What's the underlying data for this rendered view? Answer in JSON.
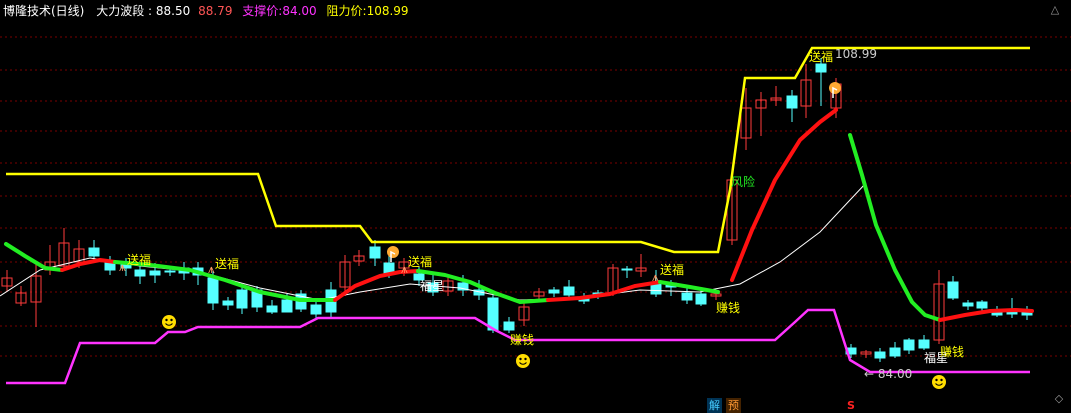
{
  "header": {
    "title": "博隆技术(日线)",
    "indicator_name": "大力波段",
    "indicator_value_1": ": 88.50",
    "indicator_value_2": "88.79",
    "support_label": "支撑价:",
    "support_value": "84.00",
    "resist_label": "阻力价:",
    "resist_value": "108.99"
  },
  "controls": {
    "up_icon": "chevron-up-icon",
    "expand_icon": "diamond-icon"
  },
  "annotations": {
    "songfu": "送福",
    "fuxing": "福星",
    "zhuanqian": "赚钱",
    "fengxian": "风险",
    "high_price": "108.99",
    "low_price": "84.00"
  },
  "bottom_badges": {
    "jie": "解",
    "yu": "预",
    "s": "S"
  },
  "colors": {
    "resistance_line": "#ffff00",
    "support_line": "#ff33ff",
    "trend_up": "#ff1111",
    "trend_down": "#22ee22",
    "up_candle": "#ff3b3b",
    "down_candle": "#55ffff",
    "grid": "#7a0000"
  }
}
